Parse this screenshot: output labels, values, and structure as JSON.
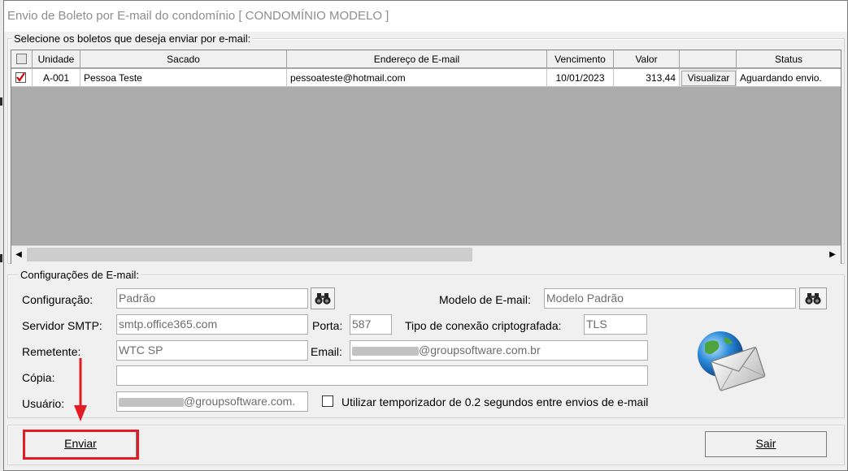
{
  "window": {
    "title": "Envio de Boleto por E-mail do condomínio [ CONDOMÍNIO MODELO ]"
  },
  "boletos": {
    "legend": "Selecione os boletos que deseja enviar por e-mail:",
    "columns": [
      "Unidade",
      "Sacado",
      "Endereço de E-mail",
      "Vencimento",
      "Valor",
      "",
      "Status"
    ],
    "rows": [
      {
        "checked": true,
        "unidade": "A-001",
        "sacado": "Pessoa Teste",
        "email": "pessoateste@hotmail.com",
        "vencimento": "10/01/2023",
        "valor": "313,44",
        "action": "Visualizar",
        "status": "Aguardando envio."
      }
    ]
  },
  "config": {
    "legend": "Configurações de E-mail:",
    "configuracao_label": "Configuração:",
    "configuracao_value": "Padrão",
    "modelo_label": "Modelo de E-mail:",
    "modelo_value": "Modelo Padrão",
    "smtp_label": "Servidor SMTP:",
    "smtp_value": "smtp.office365.com",
    "porta_label": "Porta:",
    "porta_value": "587",
    "cripto_label": "Tipo de conexão criptografada:",
    "cripto_value": "TLS",
    "remetente_label": "Remetente:",
    "remetente_value": "WTC SP",
    "email_label": "Email:",
    "email_value": "@groupsoftware.com.br",
    "copia_label": "Cópia:",
    "copia_value": "",
    "usuario_label": "Usuário:",
    "usuario_value": "@groupsoftware.com.",
    "timer_label": "Utilizar temporizador de 0.2 segundos entre envios de e-mail",
    "timer_checked": false
  },
  "actions": {
    "send_label": "Enviar",
    "exit_label": "Sair"
  },
  "colors": {
    "highlight": "#e31b23",
    "grid_background": "#acacac"
  }
}
